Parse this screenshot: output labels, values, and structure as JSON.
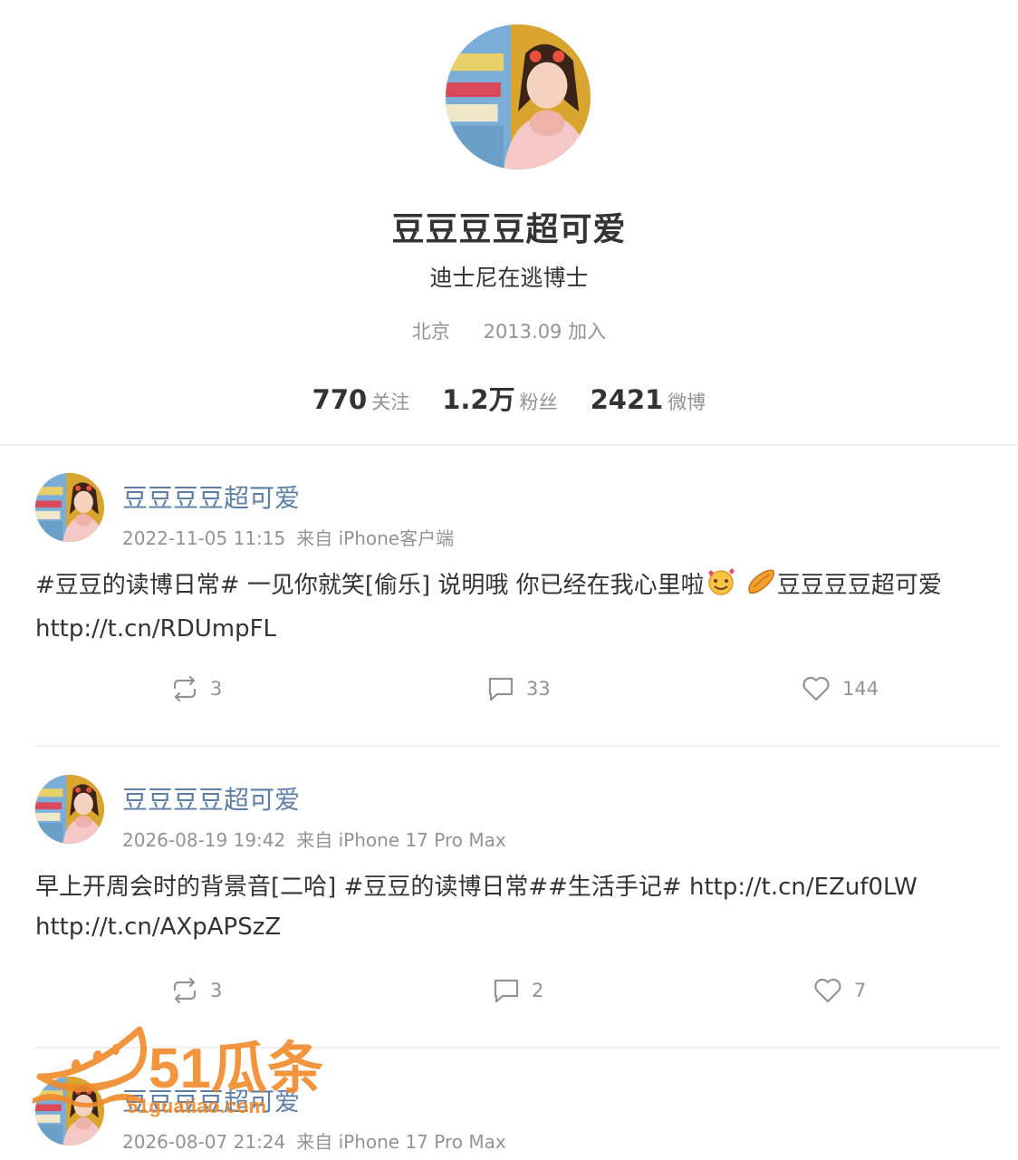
{
  "profile": {
    "name": "豆豆豆豆超可爱",
    "bio": "迪士尼在逃博士",
    "location": "北京",
    "joined": "2013.09 加入",
    "stats": [
      {
        "num": "770",
        "label": "关注"
      },
      {
        "num": "1.2万",
        "label": "粉丝"
      },
      {
        "num": "2421",
        "label": "微博"
      }
    ]
  },
  "posts": [
    {
      "author": "豆豆豆豆超可爱",
      "time": "2022-11-05 11:15",
      "source": "来自 iPhone客户端",
      "text_a": "#豆豆的读博日常# 一见你就笑[偷乐] 说明哦 你已经在我心里啦",
      "text_b": "豆豆豆豆超可爱",
      "link": "http://t.cn/RDUmpFL",
      "reposts": "3",
      "comments": "33",
      "likes": "144"
    },
    {
      "author": "豆豆豆豆超可爱",
      "time": "2026-08-19 19:42",
      "source": "来自 iPhone 17 Pro Max",
      "text_a": "早上开周会时的背景音[二哈] #豆豆的读博日常##生活手记#",
      "link": "http://t.cn/EZuf0LW",
      "link2": "http://t.cn/AXpAPSzZ",
      "reposts": "3",
      "comments": "2",
      "likes": "7"
    },
    {
      "author": "豆豆豆豆超可爱",
      "time": "2026-08-07 21:24",
      "source": "来自 iPhone 17 Pro Max"
    }
  ],
  "watermark": {
    "brand": "51瓜条",
    "url": "51guatiao.com"
  },
  "colors": {
    "author_link": "#5d7fa6",
    "muted": "#939393",
    "watermark": "#f08a2b"
  }
}
